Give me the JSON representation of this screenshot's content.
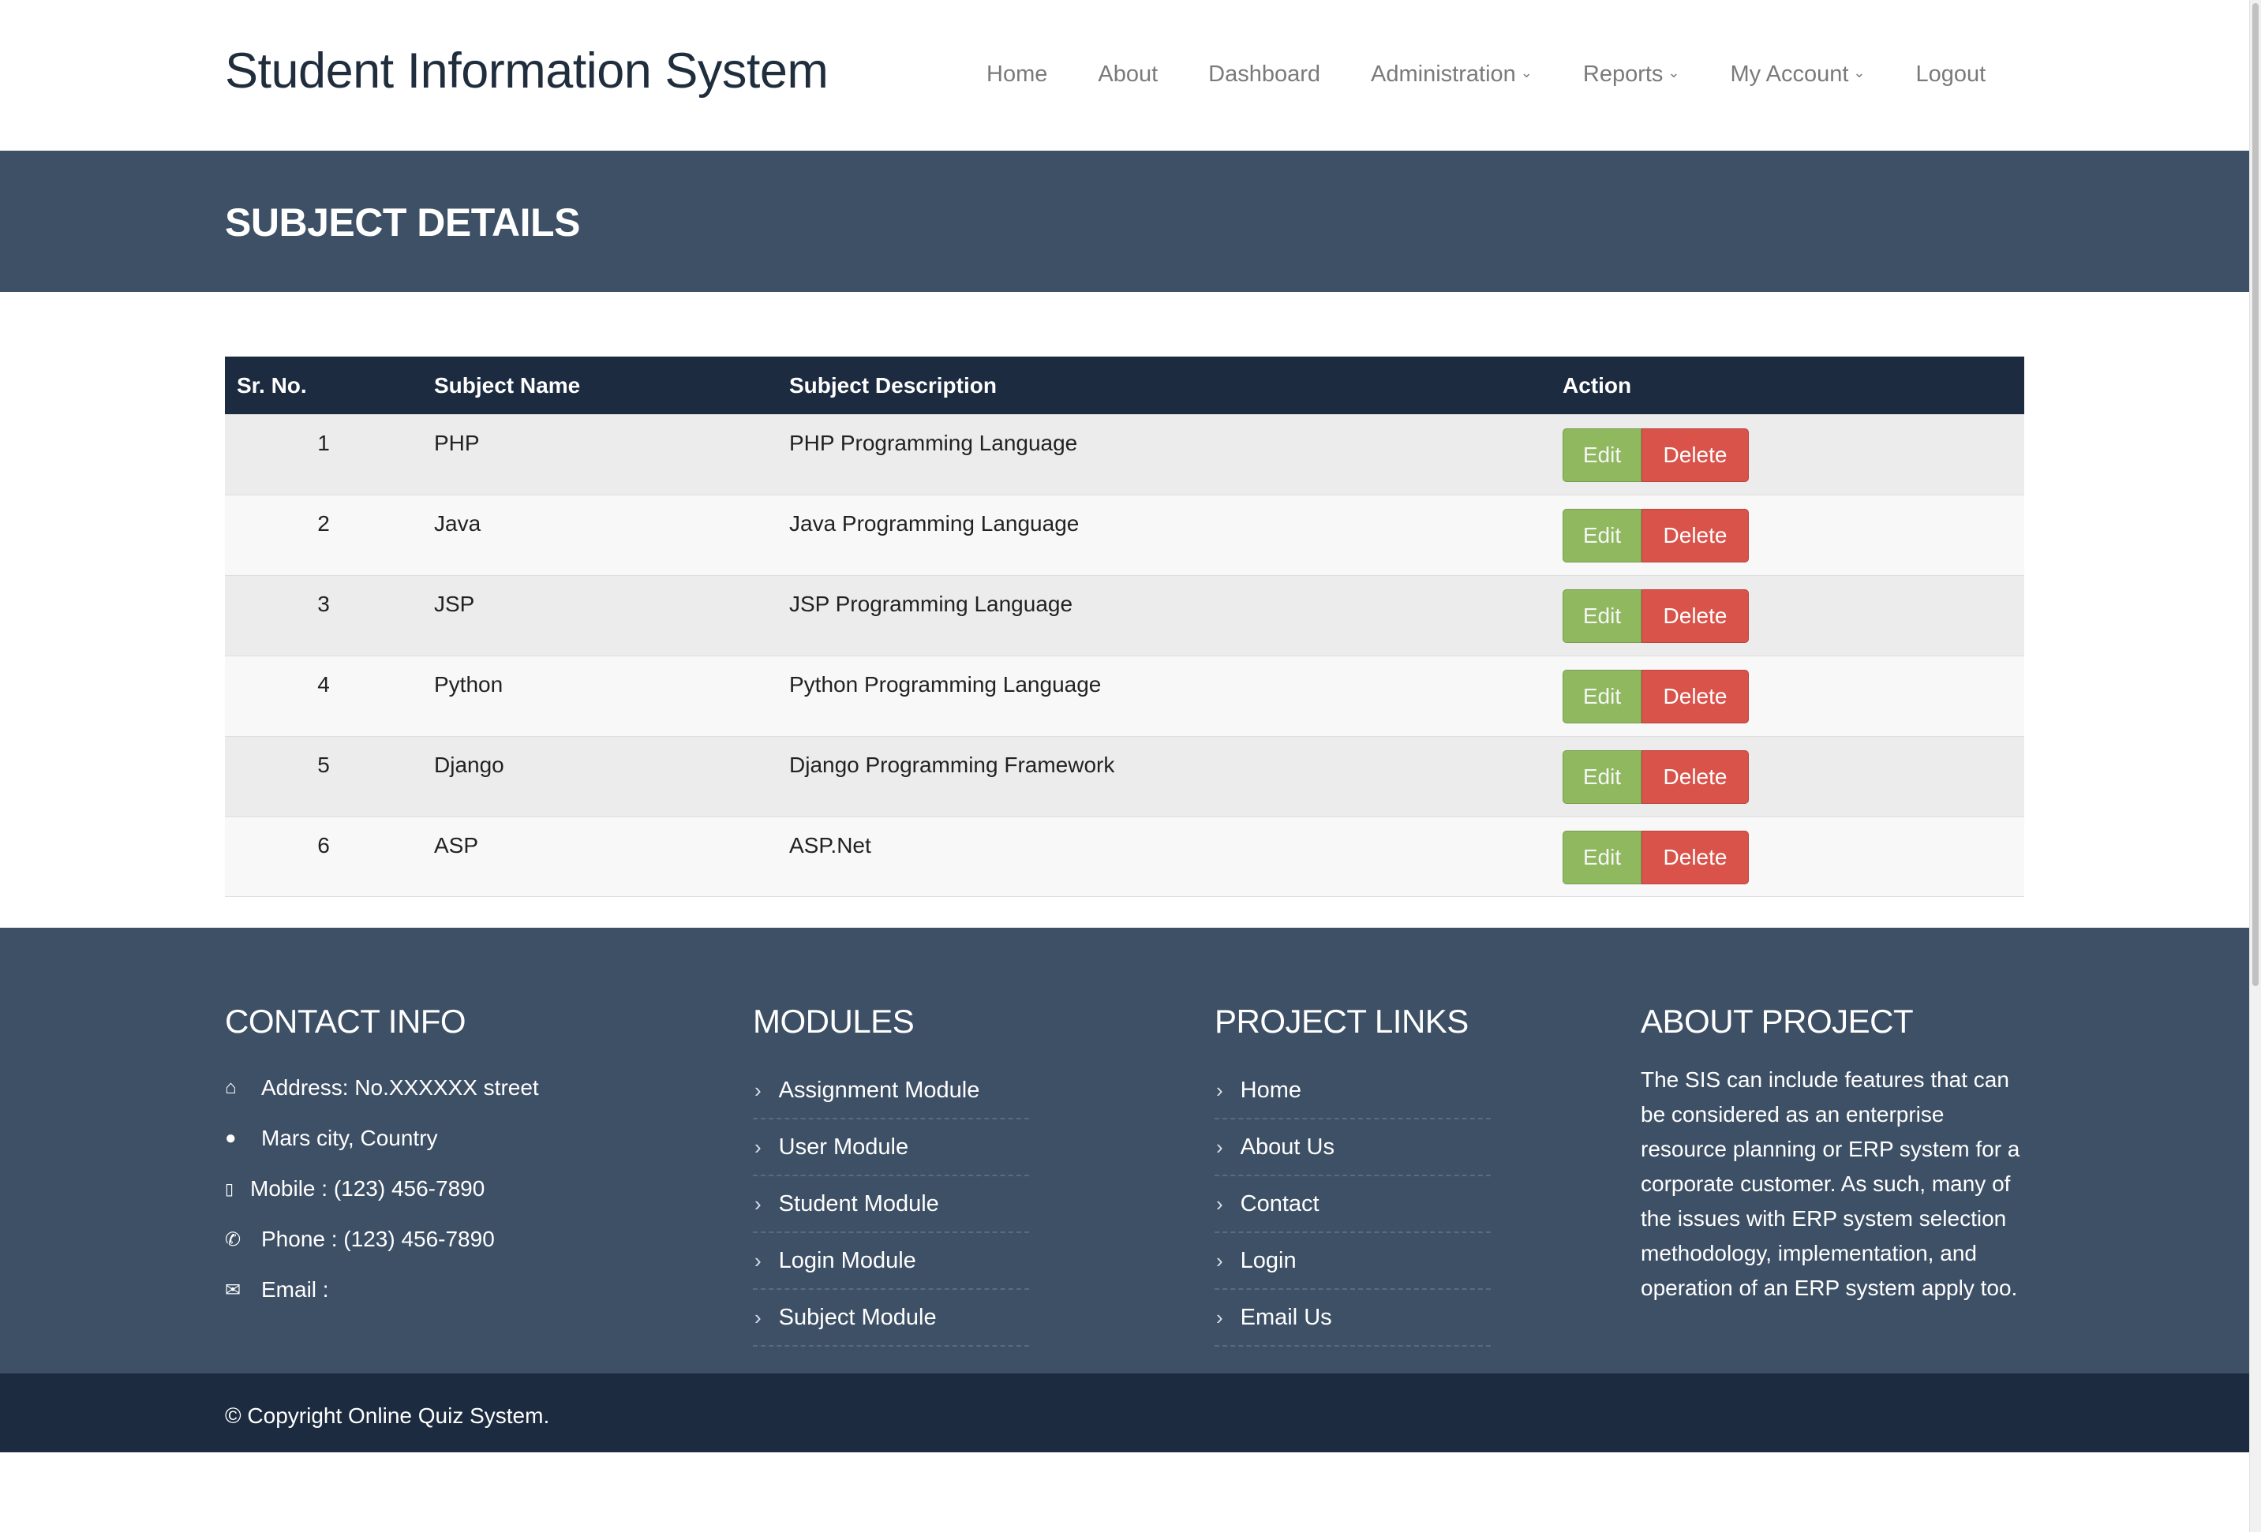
{
  "brand": "Student Information System",
  "nav": [
    {
      "label": "Home"
    },
    {
      "label": "About"
    },
    {
      "label": "Dashboard"
    },
    {
      "label": "Administration"
    },
    {
      "label": "Reports"
    },
    {
      "label": "My Account"
    },
    {
      "label": "Logout"
    }
  ],
  "banner_title": "SUBJECT DETAILS",
  "table": {
    "headers": [
      "Sr. No.",
      "Subject Name",
      "Subject Description",
      "Action"
    ],
    "rows": [
      {
        "no": "1",
        "name": "PHP",
        "desc": "PHP Programming Language"
      },
      {
        "no": "2",
        "name": "Java",
        "desc": "Java Programming Language"
      },
      {
        "no": "3",
        "name": "JSP",
        "desc": "JSP Programming Language"
      },
      {
        "no": "4",
        "name": "Python",
        "desc": "Python Programming Language"
      },
      {
        "no": "5",
        "name": "Django",
        "desc": "Django Programming Framework"
      },
      {
        "no": "6",
        "name": "ASP",
        "desc": "ASP.Net"
      }
    ],
    "edit_label": "Edit",
    "delete_label": "Delete"
  },
  "footer": {
    "contact": {
      "title": "CONTACT INFO",
      "lines": [
        {
          "icon": "home-icon",
          "text": "Address: No.XXXXXX street"
        },
        {
          "icon": "globe-icon",
          "text": "Mars city, Country"
        },
        {
          "icon": "mobile-icon",
          "text": "Mobile : (123) 456-7890"
        },
        {
          "icon": "phone-icon",
          "text": "Phone : (123) 456-7890"
        },
        {
          "icon": "envelope-icon",
          "text": "Email :"
        }
      ]
    },
    "modules": {
      "title": "MODULES",
      "items": [
        "Assignment Module",
        "User Module",
        "Student Module",
        "Login Module",
        "Subject Module"
      ]
    },
    "project_links": {
      "title": "PROJECT LINKS",
      "items": [
        "Home",
        "About Us",
        "Contact",
        "Login",
        "Email Us"
      ]
    },
    "about": {
      "title": "ABOUT PROJECT",
      "text": "The SIS can include features that can be considered as an enterprise resource planning or ERP system for a corporate customer. As such, many of the issues with ERP system selection methodology, implementation, and operation of an ERP system apply too."
    },
    "copyright": "© Copyright Online Quiz System."
  },
  "colors": {
    "banner_bg": "#3e5066",
    "table_header_bg": "#1c2b3f",
    "edit_btn": "#8fb85f",
    "delete_btn": "#d9534a"
  }
}
